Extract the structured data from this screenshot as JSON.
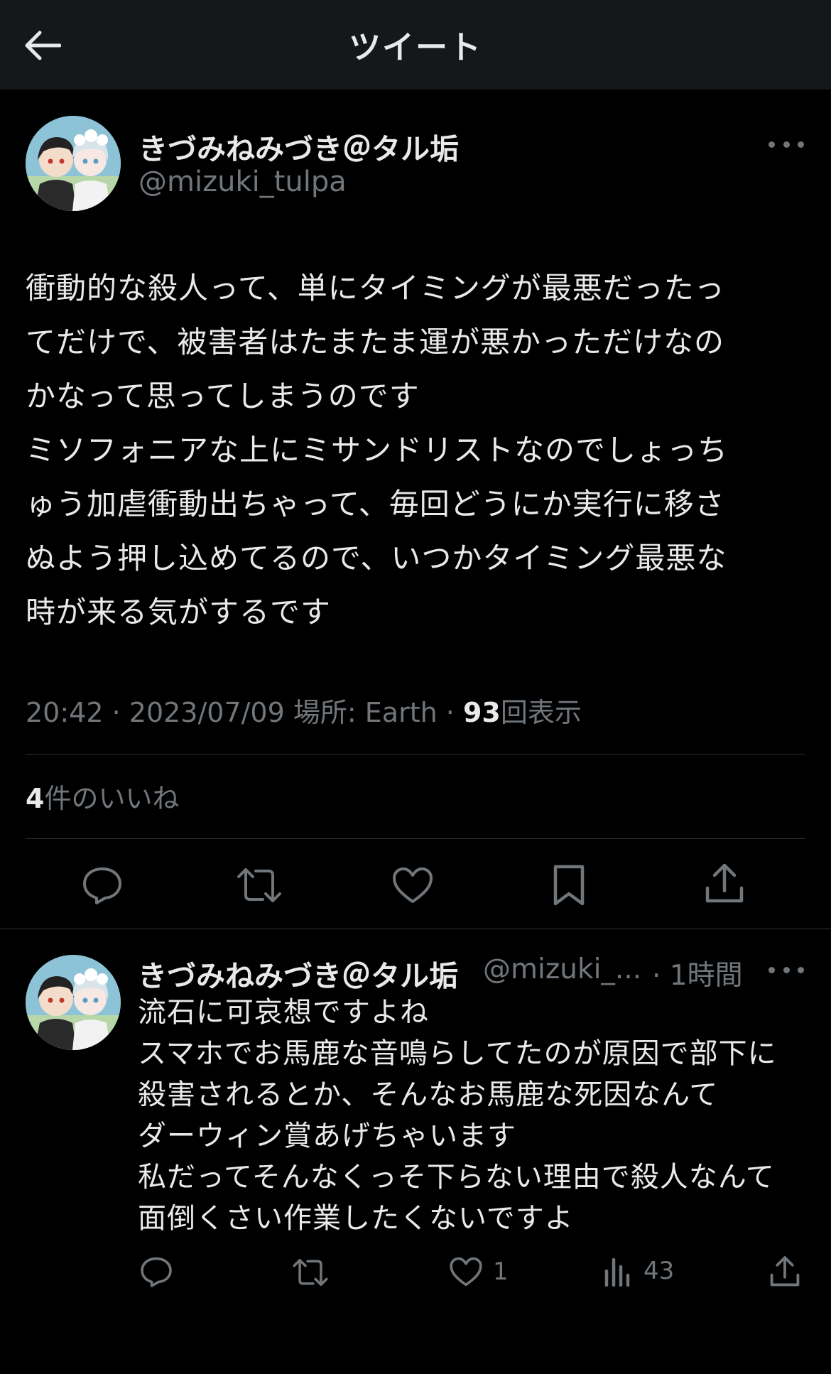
{
  "header": {
    "title": "ツイート",
    "back_icon": "arrow-left-icon"
  },
  "tweet": {
    "author_name": "きづみねみづき＠タル垢",
    "author_handle": "@mizuki_tulpa",
    "text": "衝動的な殺人って、単にタイミングが最悪だったっ\nてだけで、被害者はたまたま運が悪かっただけなの\nかなって思ってしまうのです\nミソフォニアな上にミサンドリストなのでしょっち\nゅう加虐衝動出ちゃって、毎回どうにか実行に移さ\nぬよう押し込めてるので、いつかタイミング最悪な\n時が来る気がするです",
    "time": "20:42",
    "separator": " · ",
    "date": "2023/07/09",
    "location_label": "場所: Earth",
    "views_count": "93",
    "views_label": "回表示",
    "likes_count": "4",
    "likes_label": "件のいいね"
  },
  "actions": [
    "reply-icon",
    "retweet-icon",
    "like-icon",
    "bookmark-icon",
    "share-icon"
  ],
  "reply": {
    "author_name": "きづみねみづき＠タル垢",
    "author_handle": "@mizuki_...",
    "time_ago": "· 1時間",
    "text": "流石に可哀想ですよね\nスマホでお馬鹿な音鳴らしてたのが原因で部下に\n殺害されるとか、そんなお馬鹿な死因なんて\nダーウィン賞あげちゃいます\n私だってそんなくっそ下らない理由で殺人なんて\n面倒くさい作業したくないですよ",
    "like_count": "1",
    "views_count": "43"
  },
  "colors": {
    "background": "#000000",
    "header": "#16171a",
    "text": "#e7e9ea",
    "muted": "#71767b",
    "divider": "#2f3336"
  }
}
